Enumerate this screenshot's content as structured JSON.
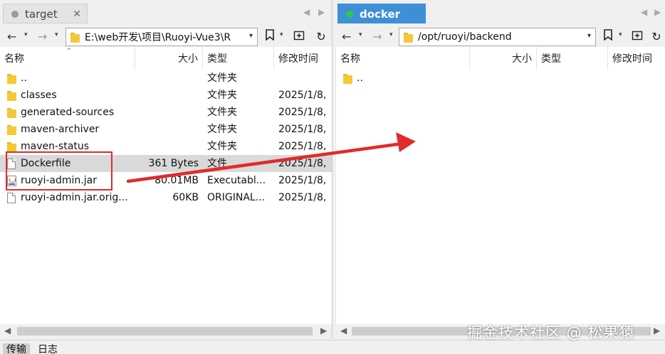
{
  "left": {
    "tab": {
      "title": "target"
    },
    "path": "E:\\web开发\\项目\\Ruoyi-Vue3\\R",
    "columns": {
      "name": "名称",
      "size": "大小",
      "type": "类型",
      "modified": "修改时间"
    },
    "rows": [
      {
        "icon": "folder-icon",
        "name": "..",
        "size": "",
        "type": "文件夹",
        "modified": ""
      },
      {
        "icon": "folder-icon",
        "name": "classes",
        "size": "",
        "type": "文件夹",
        "modified": "2025/1/8,"
      },
      {
        "icon": "folder-icon",
        "name": "generated-sources",
        "size": "",
        "type": "文件夹",
        "modified": "2025/1/8,"
      },
      {
        "icon": "folder-icon",
        "name": "maven-archiver",
        "size": "",
        "type": "文件夹",
        "modified": "2025/1/8,"
      },
      {
        "icon": "folder-icon",
        "name": "maven-status",
        "size": "",
        "type": "文件夹",
        "modified": "2025/1/8,"
      },
      {
        "icon": "file-icon",
        "name": "Dockerfile",
        "size": "361 Bytes",
        "type": "文件",
        "modified": "2025/1/8,",
        "selected": true
      },
      {
        "icon": "jar-icon",
        "name": "ruoyi-admin.jar",
        "size": "80.01MB",
        "type": "Executabl...",
        "modified": "2025/1/8,"
      },
      {
        "icon": "file-icon",
        "name": "ruoyi-admin.jar.orig...",
        "size": "60KB",
        "type": "ORIGINAL...",
        "modified": "2025/1/8,"
      }
    ]
  },
  "right": {
    "tab": {
      "title": "docker"
    },
    "path": "/opt/ruoyi/backend",
    "columns": {
      "name": "名称",
      "size": "大小",
      "type": "类型",
      "modified": "修改时间"
    },
    "rows": [
      {
        "icon": "folder-icon",
        "name": "..",
        "size": "",
        "type": "",
        "modified": ""
      }
    ]
  },
  "bottom_tabs": [
    "传输",
    "日志"
  ],
  "watermark": "掘金技术社区 @ 松果猿",
  "colors": {
    "active_tab": "#3d8fd6",
    "annotation": "#e02b2b",
    "selected_row": "#d9d9d9"
  }
}
